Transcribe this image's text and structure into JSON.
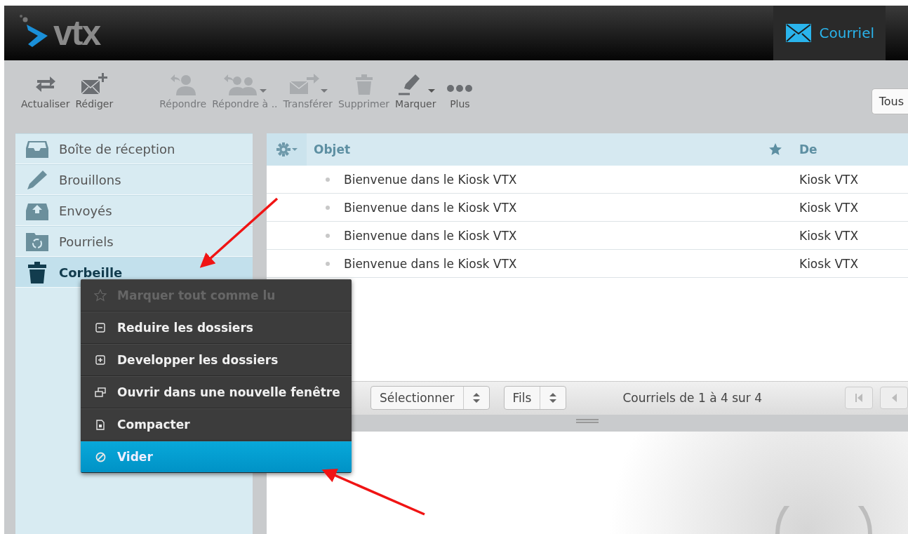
{
  "header": {
    "logo": "vtx",
    "tabs": [
      {
        "label": "Courriel",
        "selected": true
      }
    ]
  },
  "toolbar": {
    "buttons": [
      {
        "label": "Actualiser",
        "kind": "refresh",
        "disabled": false,
        "dropdown": false
      },
      {
        "label": "Rédiger",
        "kind": "compose",
        "disabled": false,
        "dropdown": false
      },
      {
        "label": "Répondre",
        "kind": "reply",
        "disabled": true,
        "dropdown": false
      },
      {
        "label": "Répondre à ..",
        "kind": "reply-all",
        "disabled": true,
        "dropdown": true
      },
      {
        "label": "Transférer",
        "kind": "forward",
        "disabled": true,
        "dropdown": true
      },
      {
        "label": "Supprimer",
        "kind": "delete",
        "disabled": true,
        "dropdown": false
      },
      {
        "label": "Marquer",
        "kind": "mark",
        "disabled": false,
        "dropdown": true
      },
      {
        "label": "Plus",
        "kind": "more",
        "disabled": false,
        "dropdown": false
      }
    ],
    "filter": "Tous"
  },
  "sidebar": {
    "folders": [
      {
        "label": "Boîte de réception",
        "kind": "inbox",
        "selected": false
      },
      {
        "label": "Brouillons",
        "kind": "drafts",
        "selected": false
      },
      {
        "label": "Envoyés",
        "kind": "sent",
        "selected": false
      },
      {
        "label": "Pourriels",
        "kind": "junk",
        "selected": false
      },
      {
        "label": "Corbeille",
        "kind": "trash",
        "selected": true
      }
    ]
  },
  "table": {
    "columns": [
      "Objet",
      "De"
    ],
    "rows": [
      {
        "subject": "Bienvenue dans le Kiosk VTX",
        "from": "Kiosk VTX"
      },
      {
        "subject": "Bienvenue dans le Kiosk VTX",
        "from": "Kiosk VTX"
      },
      {
        "subject": "Bienvenue dans le Kiosk VTX",
        "from": "Kiosk VTX"
      },
      {
        "subject": "Bienvenue dans le Kiosk VTX",
        "from": "Kiosk VTX"
      }
    ]
  },
  "list_footer": {
    "select": "Sélectionner",
    "threads": "Fils",
    "count": "Courriels de 1 à 4 sur 4"
  },
  "context_menu": {
    "items": [
      {
        "label": "Marquer tout comme lu",
        "kind": "star",
        "disabled": true,
        "selected": false
      },
      {
        "label": "Reduire les dossiers",
        "kind": "collapse",
        "disabled": false,
        "selected": false
      },
      {
        "label": "Developper les dossiers",
        "kind": "expand",
        "disabled": false,
        "selected": false
      },
      {
        "label": "Ouvrir dans une nouvelle fenêtre",
        "kind": "window",
        "disabled": false,
        "selected": false
      },
      {
        "label": "Compacter",
        "kind": "compact",
        "disabled": false,
        "selected": false
      },
      {
        "label": "Vider",
        "kind": "empty",
        "disabled": false,
        "selected": true
      }
    ]
  }
}
